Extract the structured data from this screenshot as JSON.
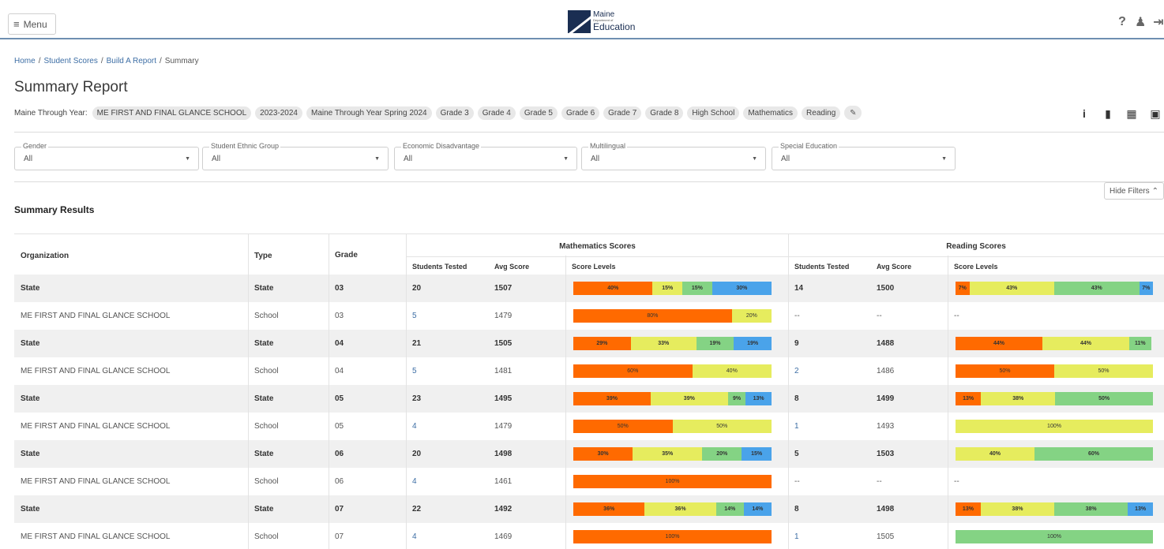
{
  "colors": {
    "level1": "#ff6a00",
    "level2": "#e6ec5e",
    "level3": "#84d384",
    "level4": "#4aa3ea",
    "link": "#3d6ea5"
  },
  "topbar": {
    "menu_label": "Menu",
    "menu_icon": "hamburger-icon",
    "logo": {
      "line1": "Maine",
      "line2": "Department of",
      "line3": "Education"
    },
    "icons": [
      "help-icon",
      "user-icon",
      "logout-icon"
    ]
  },
  "breadcrumb": {
    "items": [
      "Home",
      "Student Scores",
      "Build A Report",
      "Summary"
    ]
  },
  "page": {
    "title": "Summary Report",
    "chips_label": "Maine Through Year:",
    "chips": [
      "ME FIRST AND FINAL GLANCE SCHOOL",
      "2023-2024",
      "Maine Through Year Spring 2024",
      "Grade 3",
      "Grade 4",
      "Grade 5",
      "Grade 6",
      "Grade 7",
      "Grade 8",
      "High School",
      "Mathematics",
      "Reading"
    ],
    "action_icons": [
      "info-icon",
      "bookmark-icon",
      "pdf-icon",
      "excel-icon"
    ]
  },
  "filters": [
    {
      "label": "Gender",
      "value": "All"
    },
    {
      "label": "Student Ethnic Group",
      "value": "All"
    },
    {
      "label": "Economic Disadvantage",
      "value": "All"
    },
    {
      "label": "Multilingual",
      "value": "All"
    },
    {
      "label": "Special Education",
      "value": "All"
    }
  ],
  "hide_filters_label": "Hide Filters",
  "section_title": "Summary Results",
  "table": {
    "headers": {
      "organization": "Organization",
      "type": "Type",
      "grade": "Grade",
      "math_group": "Mathematics Scores",
      "reading_group": "Reading Scores",
      "students_tested": "Students Tested",
      "avg_score": "Avg Score",
      "score_levels": "Score Levels"
    },
    "rows": [
      {
        "org": "State",
        "type": "State",
        "grade": "03",
        "m_tested": "20",
        "m_avg": "1507",
        "m_levels": [
          40,
          15,
          15,
          30
        ],
        "r_tested": "14",
        "r_avg": "1500",
        "r_levels": [
          7,
          43,
          43,
          7
        ]
      },
      {
        "org": "ME FIRST AND FINAL GLANCE SCHOOL",
        "type": "School",
        "grade": "03",
        "m_tested": "5",
        "m_avg": "1479",
        "m_levels": [
          80,
          20,
          0,
          0
        ],
        "r_tested": "--",
        "r_avg": "--",
        "r_levels": null
      },
      {
        "org": "State",
        "type": "State",
        "grade": "04",
        "m_tested": "21",
        "m_avg": "1505",
        "m_levels": [
          29,
          33,
          19,
          19
        ],
        "r_tested": "9",
        "r_avg": "1488",
        "r_levels": [
          44,
          44,
          11,
          0
        ]
      },
      {
        "org": "ME FIRST AND FINAL GLANCE SCHOOL",
        "type": "School",
        "grade": "04",
        "m_tested": "5",
        "m_avg": "1481",
        "m_levels": [
          60,
          40,
          0,
          0
        ],
        "r_tested": "2",
        "r_avg": "1486",
        "r_levels": [
          50,
          50,
          0,
          0
        ]
      },
      {
        "org": "State",
        "type": "State",
        "grade": "05",
        "m_tested": "23",
        "m_avg": "1495",
        "m_levels": [
          39,
          39,
          9,
          13
        ],
        "r_tested": "8",
        "r_avg": "1499",
        "r_levels": [
          13,
          38,
          50,
          0
        ]
      },
      {
        "org": "ME FIRST AND FINAL GLANCE SCHOOL",
        "type": "School",
        "grade": "05",
        "m_tested": "4",
        "m_avg": "1479",
        "m_levels": [
          50,
          50,
          0,
          0
        ],
        "r_tested": "1",
        "r_avg": "1493",
        "r_levels": [
          0,
          100,
          0,
          0
        ]
      },
      {
        "org": "State",
        "type": "State",
        "grade": "06",
        "m_tested": "20",
        "m_avg": "1498",
        "m_levels": [
          30,
          35,
          20,
          15
        ],
        "r_tested": "5",
        "r_avg": "1503",
        "r_levels": [
          0,
          40,
          60,
          0
        ]
      },
      {
        "org": "ME FIRST AND FINAL GLANCE SCHOOL",
        "type": "School",
        "grade": "06",
        "m_tested": "4",
        "m_avg": "1461",
        "m_levels": [
          100,
          0,
          0,
          0
        ],
        "r_tested": "--",
        "r_avg": "--",
        "r_levels": null
      },
      {
        "org": "State",
        "type": "State",
        "grade": "07",
        "m_tested": "22",
        "m_avg": "1492",
        "m_levels": [
          36,
          36,
          14,
          14
        ],
        "r_tested": "8",
        "r_avg": "1498",
        "r_levels": [
          13,
          38,
          38,
          13
        ]
      },
      {
        "org": "ME FIRST AND FINAL GLANCE SCHOOL",
        "type": "School",
        "grade": "07",
        "m_tested": "4",
        "m_avg": "1469",
        "m_levels": [
          100,
          0,
          0,
          0
        ],
        "r_tested": "1",
        "r_avg": "1505",
        "r_levels": [
          0,
          0,
          100,
          0
        ]
      }
    ],
    "empty_levels": "--"
  }
}
